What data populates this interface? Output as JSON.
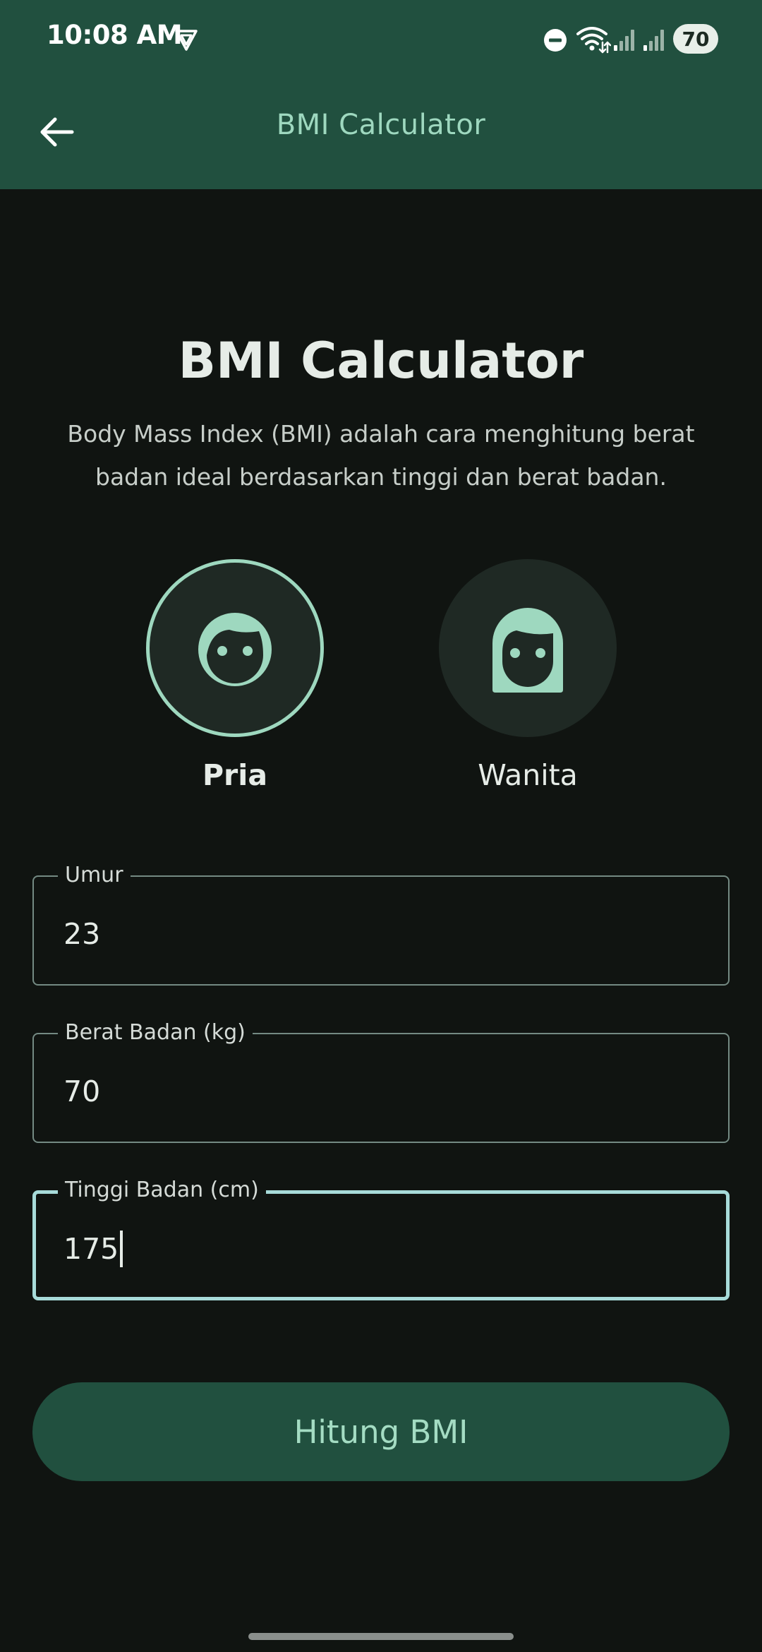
{
  "status_bar": {
    "time": "10:08 AM",
    "battery": "70"
  },
  "app_bar": {
    "title": "BMI Calculator",
    "back_icon": "arrow-left-icon"
  },
  "main": {
    "title": "BMI Calculator",
    "description": "Body Mass Index (BMI) adalah cara menghitung berat badan ideal berdasarkan tinggi dan berat badan."
  },
  "gender": {
    "selected": "male",
    "options": [
      {
        "id": "male",
        "label": "Pria",
        "icon": "male-face-icon"
      },
      {
        "id": "female",
        "label": "Wanita",
        "icon": "female-face-icon"
      }
    ]
  },
  "form": {
    "age": {
      "label": "Umur",
      "value": "23"
    },
    "weight": {
      "label": "Berat Badan (kg)",
      "value": "70"
    },
    "height": {
      "label": "Tinggi Badan (cm)",
      "value": "175"
    }
  },
  "actions": {
    "calculate_label": "Hitung BMI"
  },
  "colors": {
    "background": "#101411",
    "app_bar": "#21503f",
    "accent": "#9ed8bf",
    "focused_border": "#a7dbd9",
    "button": "#21503f",
    "button_text": "#a4dcc3"
  }
}
